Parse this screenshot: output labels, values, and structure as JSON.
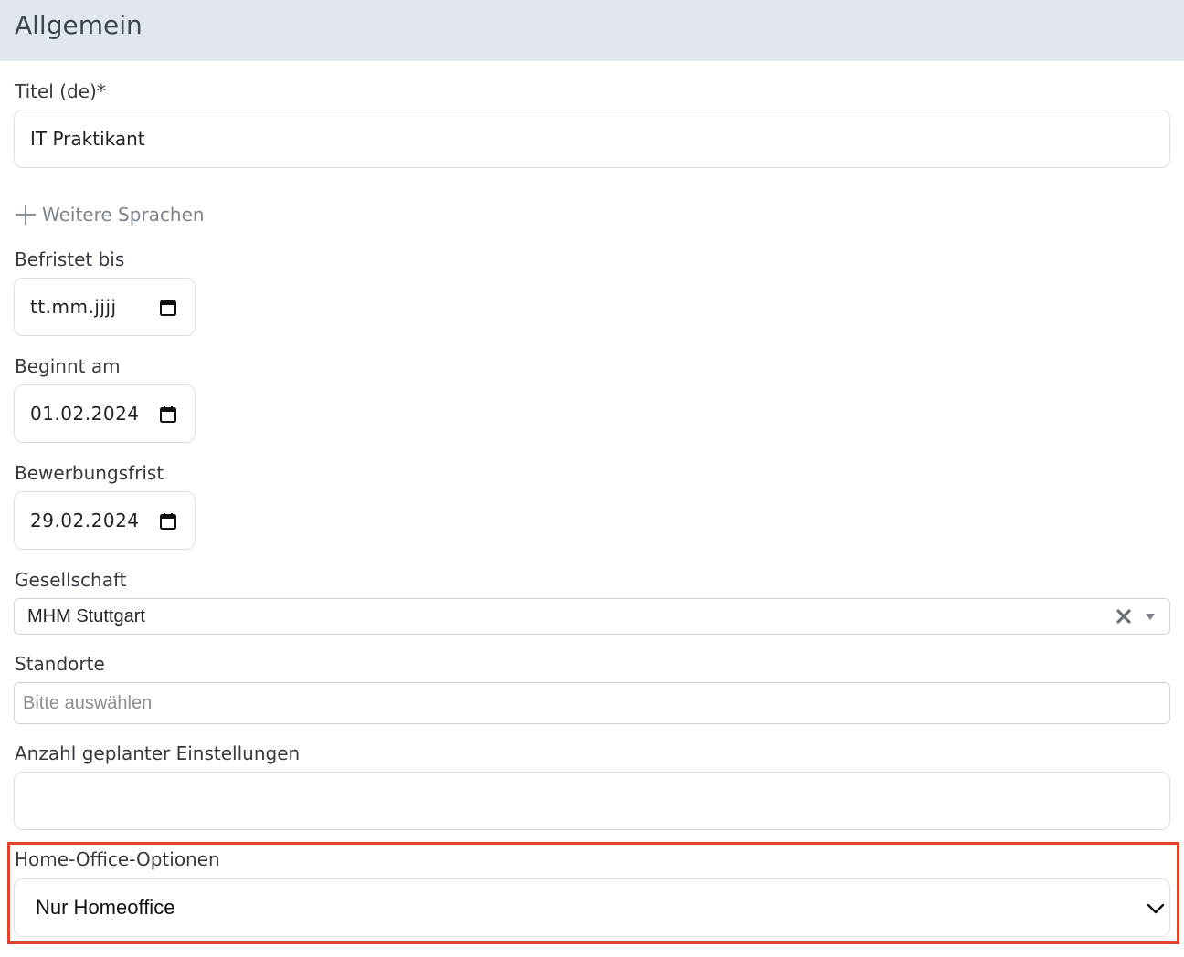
{
  "section": {
    "title": "Allgemein"
  },
  "title_field": {
    "label": "Titel (de)*",
    "value": "IT Praktikant"
  },
  "more_languages": {
    "label": "Weitere Sprachen",
    "icon": "plus-icon"
  },
  "befristet_bis": {
    "label": "Befristet bis",
    "value": "tt.mm.jjjj",
    "icon": "calendar-icon"
  },
  "beginnt_am": {
    "label": "Beginnt am",
    "value": "01.02.2024",
    "icon": "calendar-icon"
  },
  "bewerbungsfrist": {
    "label": "Bewerbungsfrist",
    "value": "29.02.2024",
    "icon": "calendar-icon"
  },
  "gesellschaft": {
    "label": "Gesellschaft",
    "value": "MHM Stuttgart",
    "clear_icon": "clear-icon",
    "arrow_icon": "dropdown-arrow-icon"
  },
  "standorte": {
    "label": "Standorte",
    "placeholder": "Bitte auswählen"
  },
  "anzahl": {
    "label": "Anzahl geplanter Einstellungen",
    "value": ""
  },
  "home_office": {
    "label": "Home-Office-Optionen",
    "value": "Nur Homeoffice",
    "icon": "chevron-down-icon"
  },
  "colors": {
    "header_bg": "#e2e6ee",
    "highlight": "#e2432a",
    "border": "#dcdfe4"
  }
}
